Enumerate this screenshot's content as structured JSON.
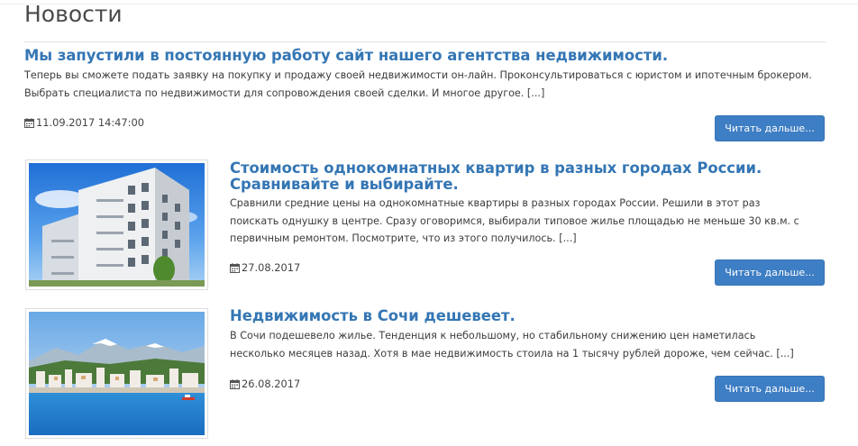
{
  "page": {
    "title": "Новости"
  },
  "news": [
    {
      "title": "Мы запустили в постоянную работу сайт нашего агентства недвижимости.",
      "text": "Теперь вы сможете подать заявку на покупку и продажу своей недвижимости он-лайн. Проконсультироваться с юристом и ипотечным брокером. Выбрать специалиста по недвижимости для сопровождения своей сделки. И многое другое. [...]",
      "date": "11.09.2017 14:47:00",
      "read_more": "Читать дальше..."
    },
    {
      "title": "Стоимость однокомнатных квартир в разных городах России. Сравнивайте и выбирайте.",
      "text": "Сравнили средние цены на однокомнатные квартиры в разных городах России. Решили в этот раз поискать однушку в центре. Сразу оговоримся, выбирали типовое жилье площадью не меньше 30 кв.м. с первичным ремонтом. Посмотрите, что из этого получилось. [...]",
      "date": "27.08.2017",
      "read_more": "Читать дальше...",
      "image": "apartment-building-photo"
    },
    {
      "title": "Недвижимость в Сочи дешевеет.",
      "text": "В Сочи подешевело жилье. Тенденция к небольшому, но стабильному снижению цен наметилась несколько месяцев назад. Хотя в мае недвижимость стоила на 1 тысячу рублей дороже, чем сейчас. [...]",
      "date": "26.08.2017",
      "read_more": "Читать дальше...",
      "image": "sochi-coast-photo"
    }
  ],
  "icons": {
    "date": "calendar-icon"
  },
  "colors": {
    "link": "#3476b4",
    "button": "#3e7ec4",
    "text": "#3d3d3d"
  }
}
